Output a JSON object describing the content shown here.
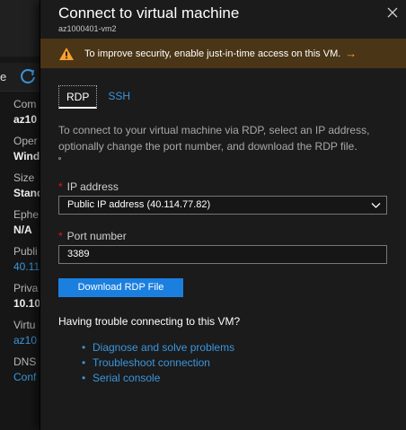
{
  "background": {
    "toolbar_text": "e",
    "items": [
      {
        "label": "Com",
        "value": "az10",
        "link": false
      },
      {
        "label": "Oper",
        "value": "Wind",
        "link": false
      },
      {
        "label": "Size",
        "value": "Stand",
        "link": false
      },
      {
        "label": "Ephe",
        "value": "N/A",
        "link": false
      },
      {
        "label": "Publi",
        "value": "40.11",
        "link": true
      },
      {
        "label": "Priva",
        "value": "10.10",
        "link": false
      },
      {
        "label": "Virtu",
        "value": "az10",
        "link": true
      },
      {
        "label": "DNS",
        "value": "Conf",
        "link": true
      }
    ]
  },
  "blade": {
    "title": "Connect to virtual machine",
    "subtitle": "az1000401-vm2",
    "warning": {
      "text": "To improve security, enable just-in-time access on this VM.",
      "arrow": "→"
    },
    "tabs": [
      {
        "label": "RDP",
        "active": true
      },
      {
        "label": "SSH",
        "active": false
      }
    ],
    "description": "To connect to your virtual machine via RDP, select an IP address, optionally change the port number, and download the RDP file.",
    "ip_label": "IP address",
    "ip_value": "Public IP address (40.114.77.82)",
    "port_label": "Port number",
    "port_value": "3389",
    "download_button": "Download RDP File",
    "trouble_title": "Having trouble connecting to this VM?",
    "links": [
      "Diagnose and solve problems",
      "Troubleshoot connection",
      "Serial console"
    ]
  },
  "colors": {
    "accent": "#1b7fe0",
    "link": "#3a96dd",
    "warning_bg": "#4a3516",
    "warning_icon": "#f7a033",
    "required": "#e81123"
  }
}
